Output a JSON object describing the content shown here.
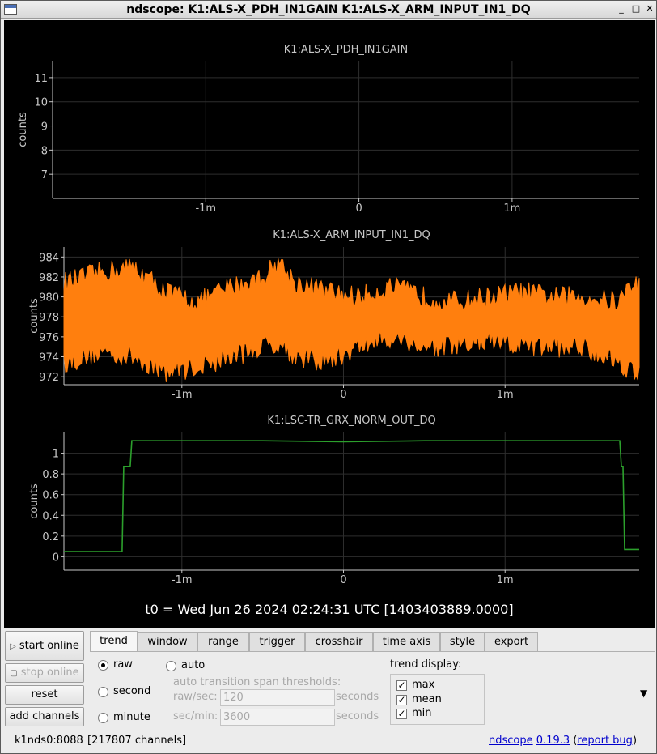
{
  "window": {
    "title": "ndscope: K1:ALS-X_PDH_IN1GAIN K1:ALS-X_ARM_INPUT_IN1_DQ"
  },
  "colors": {
    "plot_bg": "#000000",
    "grid": "#2e2e2e",
    "axis": "#c8c8c8",
    "series1": "#5a6ee0",
    "series2": "#ff7f0e",
    "series3": "#2ca02c"
  },
  "plots": [
    {
      "title": "K1:ALS-X_PDH_IN1GAIN",
      "ylabel": "counts",
      "yticks": [
        "11",
        "10",
        "9",
        "8",
        "7"
      ],
      "xticks": [
        "-1m",
        "0",
        "1m"
      ]
    },
    {
      "title": "K1:ALS-X_ARM_INPUT_IN1_DQ",
      "ylabel": "counts",
      "yticks": [
        "984",
        "982",
        "980",
        "978",
        "976",
        "974",
        "972"
      ],
      "xticks": [
        "-1m",
        "0",
        "1m"
      ]
    },
    {
      "title": "K1:LSC-TR_GRX_NORM_OUT_DQ",
      "ylabel": "counts",
      "yticks": [
        "1",
        "0.8",
        "0.6",
        "0.4",
        "0.2",
        "0"
      ],
      "xticks": [
        "-1m",
        "0",
        "1m"
      ]
    }
  ],
  "chart_data": [
    {
      "type": "line",
      "title": "K1:ALS-X_PDH_IN1GAIN",
      "ylabel": "counts",
      "xlabel": "",
      "x_tick_labels": [
        "-1m",
        "0",
        "1m"
      ],
      "xlim_min": [
        -2.0,
        1.83
      ],
      "ylim": [
        6,
        11.7
      ],
      "grid": true,
      "series": [
        {
          "x_min": [
            -2.0,
            1.83
          ],
          "values": [
            9,
            9
          ]
        }
      ]
    },
    {
      "type": "area",
      "title": "K1:ALS-X_ARM_INPUT_IN1_DQ",
      "ylabel": "counts",
      "xlabel": "",
      "x_tick_labels": [
        "-1m",
        "0",
        "1m"
      ],
      "xlim_min": [
        -1.73,
        1.83
      ],
      "ylim": [
        971.2,
        985.0
      ],
      "grid": true,
      "series": [
        {
          "x_min": [
            -1.7,
            -1.5,
            -1.3,
            -1.1,
            -0.9,
            -0.7,
            -0.5,
            -0.4,
            -0.3,
            -0.1,
            0.1,
            0.3,
            0.5,
            0.7,
            0.9,
            1.1,
            1.3,
            1.5,
            1.7,
            1.8
          ],
          "max": [
            981.5,
            982.5,
            983.0,
            980.5,
            979.5,
            981.0,
            982.0,
            983.5,
            981.5,
            980.5,
            980.0,
            981.0,
            980.0,
            979.5,
            980.0,
            980.5,
            980.0,
            980.0,
            979.5,
            981.5
          ],
          "min": [
            973.5,
            974.5,
            974.0,
            972.5,
            973.0,
            974.0,
            975.0,
            975.5,
            974.0,
            973.5,
            975.0,
            976.0,
            975.0,
            975.0,
            975.5,
            975.0,
            975.0,
            975.0,
            973.5,
            972.5
          ]
        }
      ]
    },
    {
      "type": "line",
      "title": "K1:LSC-TR_GRX_NORM_OUT_DQ",
      "ylabel": "counts",
      "xlabel": "",
      "x_tick_labels": [
        "-1m",
        "0",
        "1m"
      ],
      "xlim_min": [
        -1.73,
        1.83
      ],
      "ylim": [
        -0.13,
        1.2
      ],
      "grid": true,
      "series": [
        {
          "x_min": [
            -1.73,
            -1.37,
            -1.36,
            -1.35,
            -1.32,
            -1.31,
            -0.5,
            0.0,
            0.5,
            1.71,
            1.72,
            1.73,
            1.74,
            1.83
          ],
          "values": [
            0.05,
            0.05,
            0.87,
            0.87,
            0.87,
            1.12,
            1.12,
            1.11,
            1.12,
            1.12,
            0.87,
            0.87,
            0.07,
            0.07
          ]
        }
      ]
    }
  ],
  "t0_label": "t0 = Wed Jun 26 2024 02:24:31 UTC [1403403889.0000]",
  "sidebar": {
    "start_online": "start online",
    "stop_online": "stop online",
    "reset": "reset",
    "add_channels": "add channels"
  },
  "tabs": [
    "trend",
    "window",
    "range",
    "trigger",
    "crosshair",
    "time axis",
    "style",
    "export"
  ],
  "trend_panel": {
    "mode_raw": "raw",
    "mode_auto": "auto",
    "mode_second": "second",
    "mode_minute": "minute",
    "selected_mode": "raw",
    "auto_thresholds_label": "auto transition span thresholds:",
    "raw_sec_label": "raw/sec:",
    "raw_sec_value": "120",
    "raw_sec_unit": "seconds",
    "sec_min_label": "sec/min:",
    "sec_min_value": "3600",
    "sec_min_unit": "seconds",
    "trend_display_label": "trend display:",
    "display_max": "max",
    "display_mean": "mean",
    "display_min": "min",
    "max_checked": true,
    "mean_checked": true,
    "min_checked": true,
    "expand_arrow": "▼"
  },
  "status": {
    "server": "k1nds0:8088",
    "channels": "[217807 channels]",
    "app_name": "ndscope",
    "version": "0.19.3",
    "report_bug": "report bug"
  }
}
